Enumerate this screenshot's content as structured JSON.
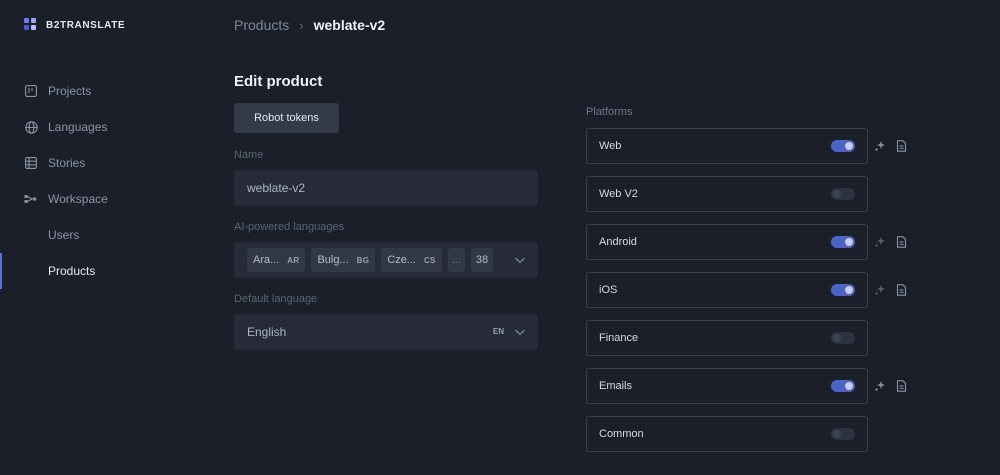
{
  "brand": {
    "name": "B2TRANSLATE",
    "icon": "b2translate-logo-icon"
  },
  "sidebar": {
    "items": [
      {
        "label": "Projects",
        "icon": "board-icon"
      },
      {
        "label": "Languages",
        "icon": "globe-icon"
      },
      {
        "label": "Stories",
        "icon": "list-icon"
      },
      {
        "label": "Workspace",
        "icon": "workspace-icon"
      },
      {
        "label": "Users"
      },
      {
        "label": "Products",
        "active": true
      }
    ]
  },
  "breadcrumb": {
    "parent": "Products",
    "separator": "›",
    "current": "weblate-v2"
  },
  "form": {
    "title": "Edit product",
    "robot_tokens_label": "Robot tokens",
    "name_label": "Name",
    "name_value": "weblate-v2",
    "ai_languages_label": "AI-powered languages",
    "ai_languages": [
      {
        "name": "Ara...",
        "code": "AR"
      },
      {
        "name": "Bulg...",
        "code": "BG"
      },
      {
        "name": "Cze...",
        "code": "CS"
      }
    ],
    "ai_languages_more": "...",
    "ai_languages_count": "38",
    "default_language_label": "Default language",
    "default_language_value": "English",
    "default_language_code": "EN"
  },
  "platforms": {
    "label": "Platforms",
    "items": [
      {
        "name": "Web",
        "enabled": true
      },
      {
        "name": "Web V2",
        "enabled": false
      },
      {
        "name": "Android",
        "enabled": true
      },
      {
        "name": "iOS",
        "enabled": true
      },
      {
        "name": "Finance",
        "enabled": false
      },
      {
        "name": "Emails",
        "enabled": true
      },
      {
        "name": "Common",
        "enabled": false
      }
    ]
  },
  "colors": {
    "background": "#1b1f29",
    "accent": "#5b6ee8",
    "toggle_on": "#4f63c4"
  }
}
